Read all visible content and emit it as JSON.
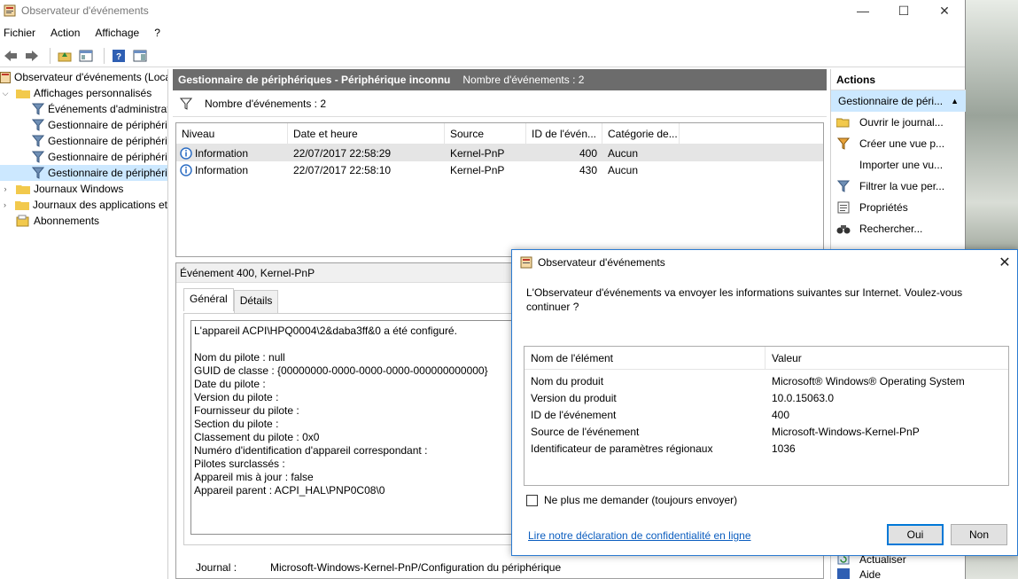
{
  "window": {
    "title": "Observateur d'événements",
    "controls": {
      "minimize": "—",
      "maximize": "☐",
      "close": "✕"
    }
  },
  "menu": [
    "Fichier",
    "Action",
    "Affichage",
    "?"
  ],
  "tree": {
    "root": "Observateur d'événements (Local)",
    "custom_views": "Affichages personnalisés",
    "children": [
      "Événements d'administration",
      "Gestionnaire de périphériques",
      "Gestionnaire de périphériques",
      "Gestionnaire de périphériques",
      "Gestionnaire de périphériques"
    ],
    "windows_logs": "Journaux Windows",
    "app_logs": "Journaux des applications et",
    "subscriptions": "Abonnements"
  },
  "center": {
    "header_title": "Gestionnaire de périphériques - Périphérique inconnu",
    "header_count": "Nombre d'événements : 2",
    "filter_label": "Nombre d'événements : 2",
    "columns": [
      "Niveau",
      "Date et heure",
      "Source",
      "ID de l'évén...",
      "Catégorie de..."
    ],
    "rows": [
      {
        "level": "Information",
        "date": "22/07/2017 22:58:29",
        "source": "Kernel-PnP",
        "id": "400",
        "category": "Aucun"
      },
      {
        "level": "Information",
        "date": "22/07/2017 22:58:10",
        "source": "Kernel-PnP",
        "id": "430",
        "category": "Aucun"
      }
    ],
    "detail_title": "Événement 400, Kernel-PnP",
    "tab_general": "Général",
    "tab_details": "Détails",
    "description": "L'appareil ACPI\\HPQ0004\\2&daba3ff&0 a été configuré.\n\nNom du pilote : null\nGUID de classe : {00000000-0000-0000-0000-000000000000}\nDate du pilote :\nVersion du pilote :\nFournisseur du pilote :\nSection du pilote :\nClassement du pilote : 0x0\nNuméro d'identification d'appareil correspondant :\nPilotes surclassés :\nAppareil mis à jour : false\nAppareil parent : ACPI_HAL\\PNP0C08\\0",
    "journal_key": "Journal :",
    "journal_value": "Microsoft-Windows-Kernel-PnP/Configuration du périphérique"
  },
  "actions": {
    "title": "Actions",
    "section": "Gestionnaire de péri...",
    "items": [
      "Ouvrir le journal...",
      "Créer une vue p...",
      "Importer une vu...",
      "Filtrer la vue per...",
      "Propriétés",
      "Rechercher..."
    ],
    "bottom_item": "Actualiser",
    "bottom_item2": "Aide"
  },
  "dialog": {
    "title": "Observateur d'événements",
    "message": "L'Observateur d'événements va envoyer les informations suivantes sur Internet. Voulez-vous continuer ?",
    "col_name": "Nom de l'élément",
    "col_value": "Valeur",
    "rows": [
      {
        "k": "Nom du produit",
        "v": "Microsoft® Windows® Operating System"
      },
      {
        "k": "Version du produit",
        "v": "10.0.15063.0"
      },
      {
        "k": "ID de l'événement",
        "v": "400"
      },
      {
        "k": "Source de l'événement",
        "v": "Microsoft-Windows-Kernel-PnP"
      },
      {
        "k": "Identificateur de paramètres régionaux",
        "v": "1036"
      }
    ],
    "checkbox": "Ne plus me demander (toujours envoyer)",
    "link": "Lire notre déclaration de confidentialité en ligne",
    "yes": "Oui",
    "no": "Non"
  }
}
